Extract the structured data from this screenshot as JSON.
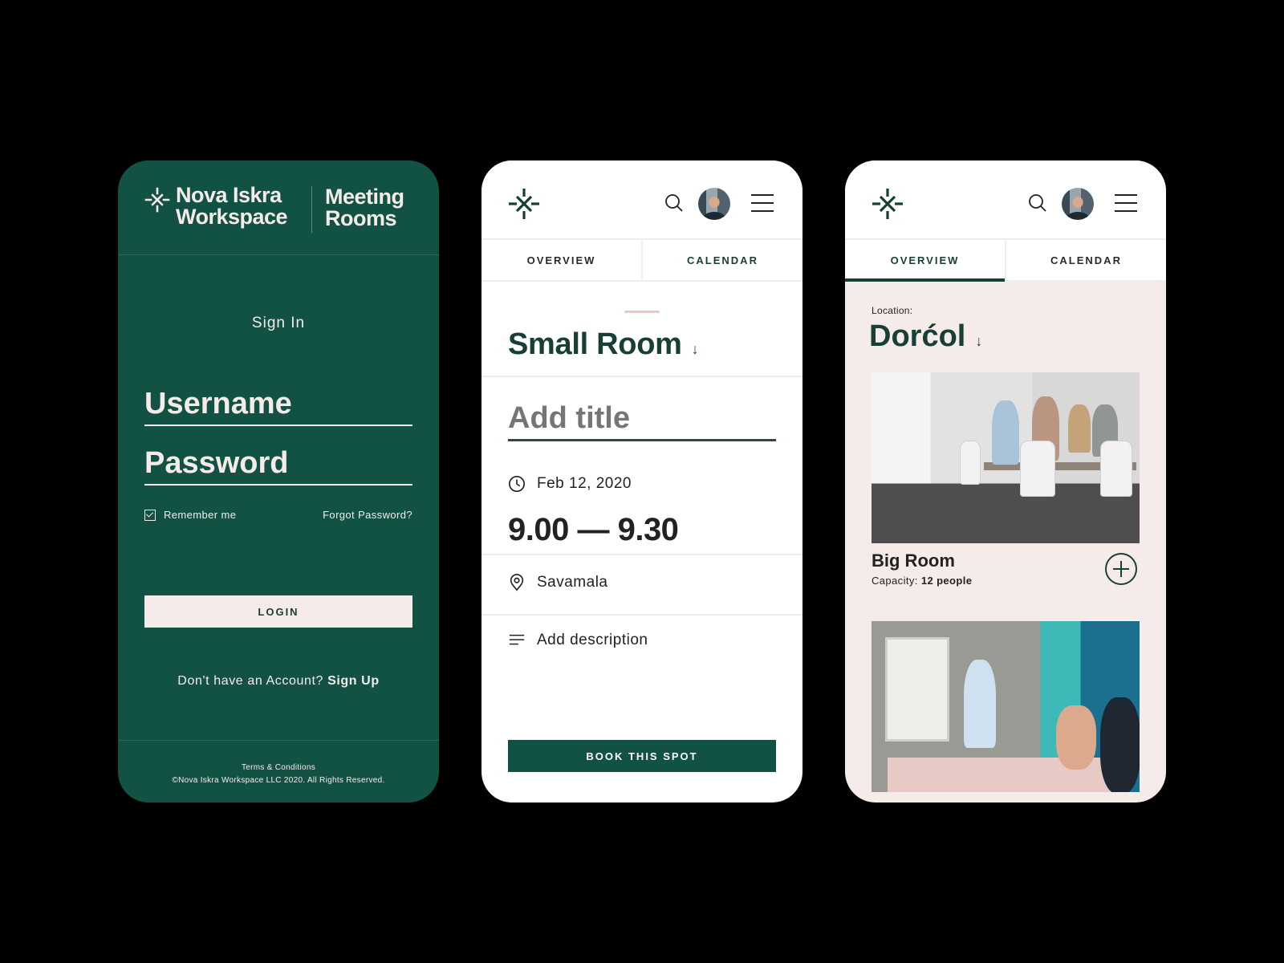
{
  "colors": {
    "brand_green": "#125245",
    "dark_green": "#173f35",
    "blush": "#f5ecea",
    "pink_accent": "#f1c4c1",
    "background": "#000000"
  },
  "login_screen": {
    "brand_name_line1": "Nova Iskra",
    "brand_name_line2": "Workspace",
    "brand_sub_line1": "Meeting",
    "brand_sub_line2": "Rooms",
    "sign_in_title": "Sign In",
    "username_placeholder": "Username",
    "password_placeholder": "Password",
    "remember_me_label": "Remember me",
    "remember_me_checked": true,
    "forgot_password_link": "Forgot Password?",
    "login_button": "LOGIN",
    "no_account_text": "Don't have an Account?",
    "sign_up_link": "Sign Up",
    "footer_terms": "Terms & Conditions",
    "footer_copyright": "©Nova Iskra Workspace LLC 2020. All Rights Reserved."
  },
  "booking_screen": {
    "header": {
      "logo_icon": "spark-asterisk-icon",
      "search_icon": "search-icon",
      "avatar": "user-avatar",
      "menu_icon": "hamburger-menu-icon"
    },
    "tabs": [
      {
        "label": "OVERVIEW",
        "active": false
      },
      {
        "label": "CALENDAR",
        "active": false
      }
    ],
    "room_name": "Small Room",
    "title_placeholder": "Add title",
    "date": "Feb 12, 2020",
    "time_range": "9.00 — 9.30",
    "location": "Savamala",
    "description_placeholder": "Add description",
    "book_button": "BOOK THIS SPOT"
  },
  "overview_screen": {
    "tabs": [
      {
        "label": "OVERVIEW",
        "active": true
      },
      {
        "label": "CALENDAR",
        "active": false
      }
    ],
    "location_label": "Location:",
    "location_value": "Dorćol",
    "rooms": [
      {
        "name": "Big Room",
        "capacity_label": "Capacity:",
        "capacity_value": "12 people"
      }
    ]
  }
}
